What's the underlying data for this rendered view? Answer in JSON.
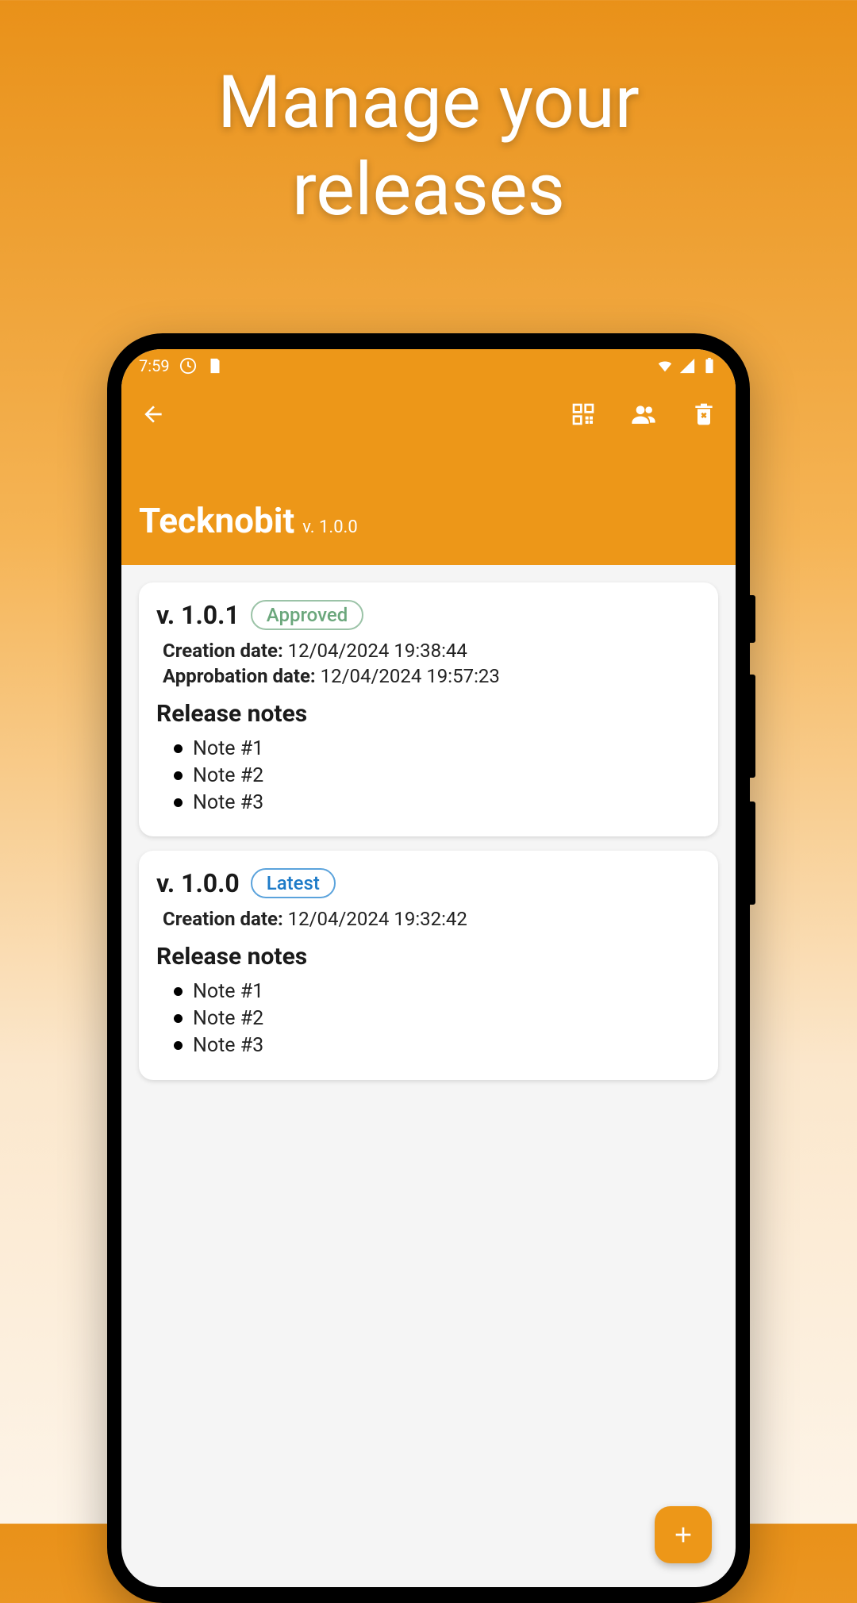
{
  "promo": {
    "title_line1": "Manage your",
    "title_line2": "releases"
  },
  "status": {
    "time": "7:59"
  },
  "header": {
    "app_name": "Tecknobit",
    "version": "v. 1.0.0"
  },
  "labels": {
    "creation_date": "Creation date:",
    "approbation_date": "Approbation date:",
    "release_notes": "Release notes"
  },
  "releases": [
    {
      "version": "v. 1.0.1",
      "badge": "Approved",
      "badge_kind": "approved",
      "creation_date": "12/04/2024 19:38:44",
      "approbation_date": "12/04/2024 19:57:23",
      "notes": [
        "Note #1",
        "Note #2",
        "Note #3"
      ]
    },
    {
      "version": "v. 1.0.0",
      "badge": "Latest",
      "badge_kind": "latest",
      "creation_date": "12/04/2024 19:32:42",
      "notes": [
        "Note #1",
        "Note #2",
        "Note #3"
      ]
    }
  ]
}
